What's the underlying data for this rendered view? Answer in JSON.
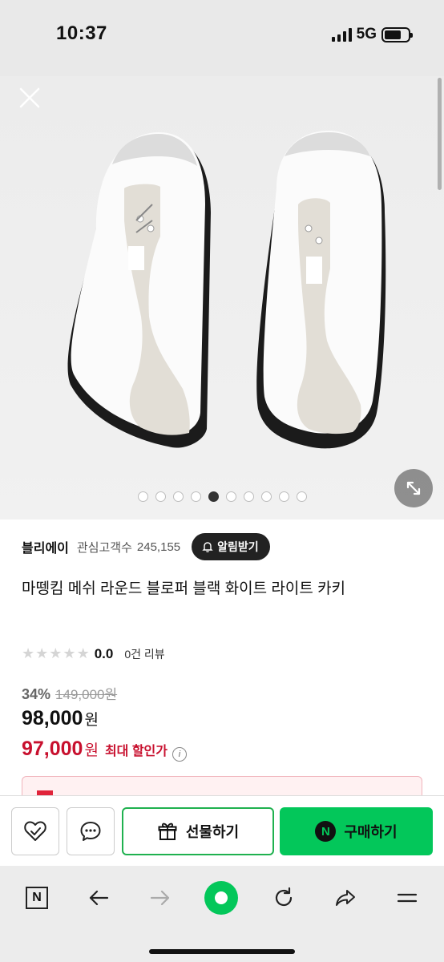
{
  "status": {
    "time": "10:37",
    "network": "5G"
  },
  "gallery": {
    "total_images": 10,
    "current_index": 5
  },
  "store": {
    "name": "블리에이",
    "fans_label": "관심고객수",
    "fans_count": "245,155",
    "alarm_label": "알림받기"
  },
  "product": {
    "title": "마뗑킴 메쉬 라운드 블로퍼 블랙 화이트 라이트 카키",
    "rating": "0.0",
    "rating_fraction": 0,
    "review_count": "0건 리뷰",
    "discount": "34%",
    "original_price": "149,000원",
    "price": "98,000",
    "price_unit": "원",
    "max_discount_price": "97,000",
    "max_discount_unit": "원",
    "max_discount_label": "최대 할인가"
  },
  "buy_bar": {
    "gift_label": "선물하기",
    "buy_label": "구매하기",
    "buy_badge": "N"
  },
  "browser": {
    "home_letter": "N"
  },
  "colors": {
    "accent_green": "#03c75a",
    "sale_red": "#c8102e"
  }
}
